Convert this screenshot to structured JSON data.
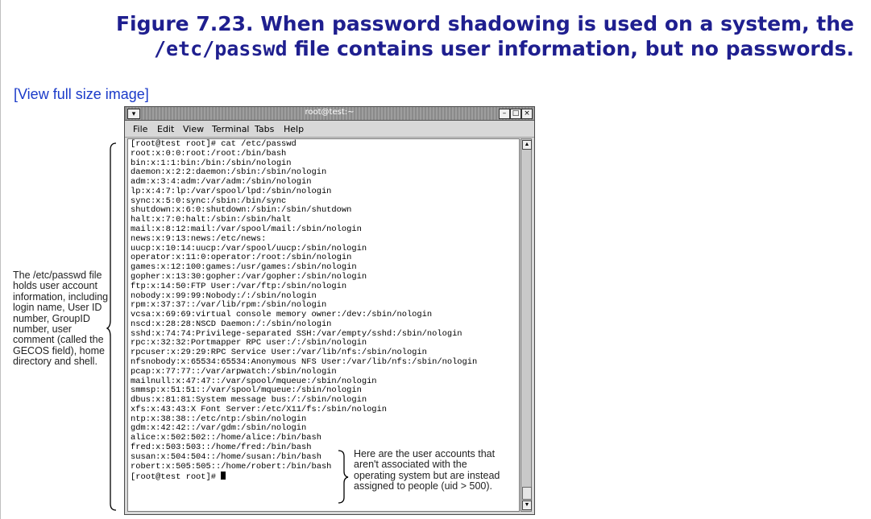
{
  "figure": {
    "caption_line1": "Figure 7.23. When password shadowing is used on a system, the",
    "caption_line2_code": "/etc/passwd",
    "caption_line2_text": " file contains user information, but no passwords.",
    "view_link": "[View full size image]"
  },
  "window": {
    "title": "root@test:~",
    "menu_button_icon": "chevron-down-icon",
    "buttons": {
      "minimize": "–",
      "maximize": "□",
      "close": "×"
    }
  },
  "menubar": {
    "items": [
      "File",
      "Edit",
      "View",
      "Terminal",
      "Tabs",
      "Help"
    ]
  },
  "terminal": {
    "lines": [
      "[root@test root]# cat /etc/passwd",
      "root:x:0:0:root:/root:/bin/bash",
      "bin:x:1:1:bin:/bin:/sbin/nologin",
      "daemon:x:2:2:daemon:/sbin:/sbin/nologin",
      "adm:x:3:4:adm:/var/adm:/sbin/nologin",
      "lp:x:4:7:lp:/var/spool/lpd:/sbin/nologin",
      "sync:x:5:0:sync:/sbin:/bin/sync",
      "shutdown:x:6:0:shutdown:/sbin:/sbin/shutdown",
      "halt:x:7:0:halt:/sbin:/sbin/halt",
      "mail:x:8:12:mail:/var/spool/mail:/sbin/nologin",
      "news:x:9:13:news:/etc/news:",
      "uucp:x:10:14:uucp:/var/spool/uucp:/sbin/nologin",
      "operator:x:11:0:operator:/root:/sbin/nologin",
      "games:x:12:100:games:/usr/games:/sbin/nologin",
      "gopher:x:13:30:gopher:/var/gopher:/sbin/nologin",
      "ftp:x:14:50:FTP User:/var/ftp:/sbin/nologin",
      "nobody:x:99:99:Nobody:/:/sbin/nologin",
      "rpm:x:37:37::/var/lib/rpm:/sbin/nologin",
      "vcsa:x:69:69:virtual console memory owner:/dev:/sbin/nologin",
      "nscd:x:28:28:NSCD Daemon:/:/sbin/nologin",
      "sshd:x:74:74:Privilege-separated SSH:/var/empty/sshd:/sbin/nologin",
      "rpc:x:32:32:Portmapper RPC user:/:/sbin/nologin",
      "rpcuser:x:29:29:RPC Service User:/var/lib/nfs:/sbin/nologin",
      "nfsnobody:x:65534:65534:Anonymous NFS User:/var/lib/nfs:/sbin/nologin",
      "pcap:x:77:77::/var/arpwatch:/sbin/nologin",
      "mailnull:x:47:47::/var/spool/mqueue:/sbin/nologin",
      "smmsp:x:51:51::/var/spool/mqueue:/sbin/nologin",
      "dbus:x:81:81:System message bus:/:/sbin/nologin",
      "xfs:x:43:43:X Font Server:/etc/X11/fs:/sbin/nologin",
      "ntp:x:38:38::/etc/ntp:/sbin/nologin",
      "gdm:x:42:42::/var/gdm:/sbin/nologin",
      "alice:x:502:502::/home/alice:/bin/bash",
      "fred:x:503:503::/home/fred:/bin/bash",
      "susan:x:504:504::/home/susan:/bin/bash",
      "robert:x:505:505::/home/robert:/bin/bash"
    ],
    "prompt": "[root@test root]# "
  },
  "annotations": {
    "left": "The /etc/passwd file holds user account information, including login name, User ID number, GroupID number, user comment (called the GECOS field), home directory and shell.",
    "right": "Here are the user accounts that aren't associated with the operating system but are instead assigned to people (uid > 500)."
  },
  "colors": {
    "caption": "#1f1f8f",
    "link": "#1a3ac9"
  }
}
